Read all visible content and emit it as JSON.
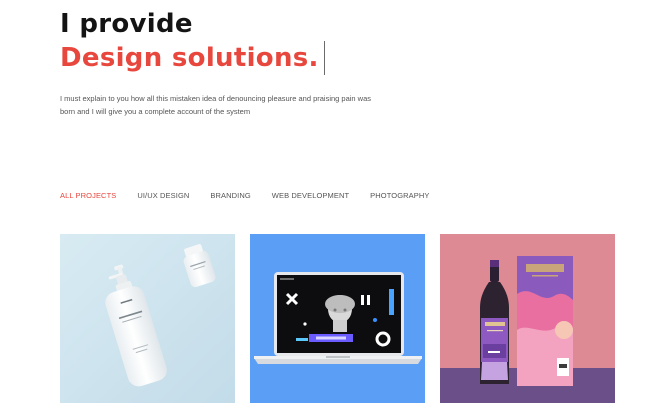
{
  "hero": {
    "line1": "I provide",
    "line2": "Design solutions.",
    "description": "I must explain to you how all this mistaken idea of denouncing pleasure and praising pain was born and I will give you a complete account of the system"
  },
  "filters": [
    {
      "label": "ALL PROJECTS",
      "active": true
    },
    {
      "label": "UI/UX DESIGN",
      "active": false
    },
    {
      "label": "BRANDING",
      "active": false
    },
    {
      "label": "WEB DEVELOPMENT",
      "active": false
    },
    {
      "label": "PHOTOGRAPHY",
      "active": false
    }
  ],
  "portfolio": {
    "items": [
      {
        "image": "cosmetic-bottles-photo",
        "bg": "#cfe4ef"
      },
      {
        "image": "laptop-mockup-photo",
        "bg": "#5a9df5",
        "screen_label": "ELEGANCE"
      },
      {
        "image": "wine-bottle-packaging-photo",
        "bg": "#de8d97",
        "bottle_label": "Essential",
        "box_label": "Essential"
      }
    ]
  },
  "colors": {
    "accent": "#e8473e",
    "heading": "#141414",
    "body_text": "#555555"
  }
}
